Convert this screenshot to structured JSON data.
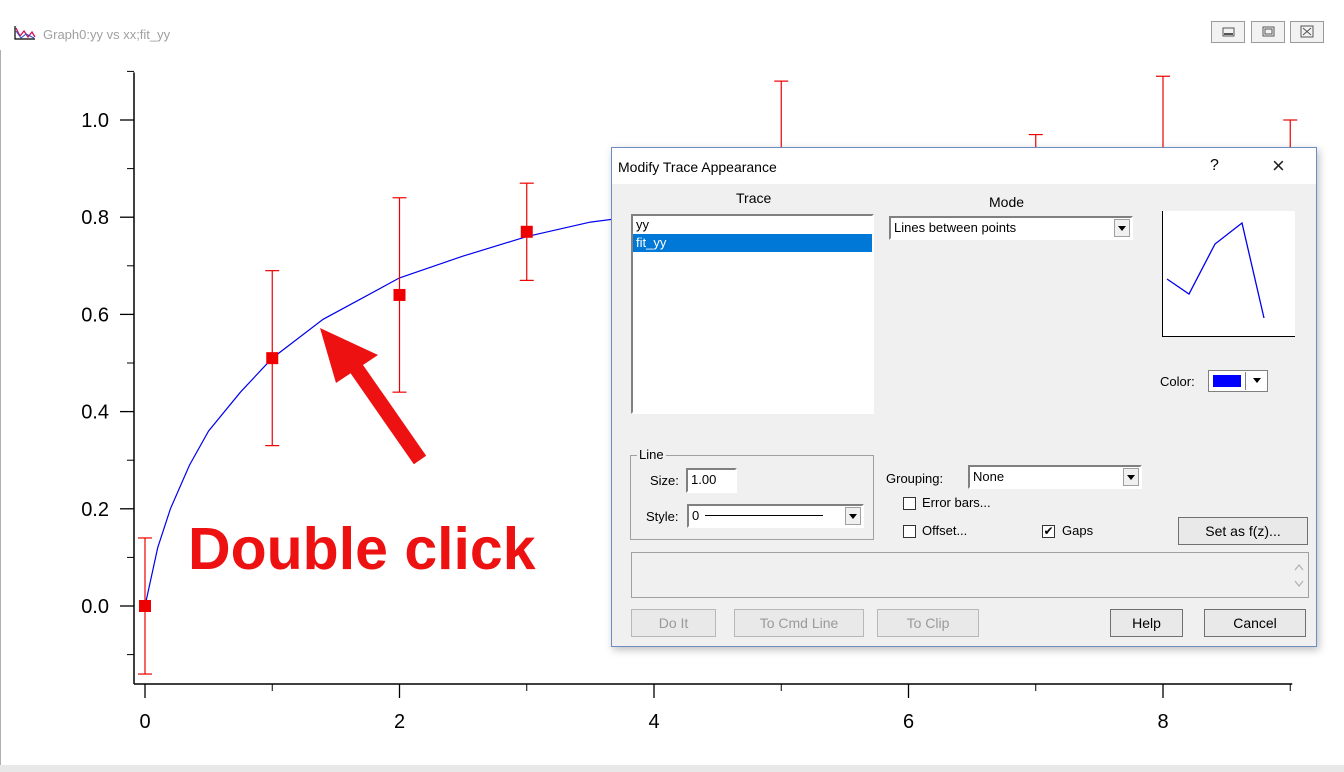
{
  "window": {
    "title": "Graph0:yy vs xx;fit_yy",
    "icon": "graph-icon"
  },
  "chart_data": {
    "type": "scatter",
    "x_ticks": [
      "0",
      "2",
      "4",
      "6",
      "8"
    ],
    "y_ticks": [
      "0.0",
      "0.2",
      "0.4",
      "0.6",
      "0.8",
      "1.0"
    ],
    "xlim": [
      0,
      9
    ],
    "ylim": [
      -0.15,
      1.1
    ],
    "series": [
      {
        "name": "yy",
        "style": "markers",
        "color": "#ee0000",
        "x": [
          0,
          1,
          2,
          3,
          5,
          7,
          8,
          9
        ],
        "y": [
          0.0,
          0.51,
          0.64,
          0.77,
          0.86,
          0.82,
          0.87,
          0.87
        ],
        "err": [
          0.14,
          0.18,
          0.2,
          0.1,
          0.22,
          0.15,
          0.22,
          0.13
        ]
      },
      {
        "name": "fit_yy",
        "style": "line",
        "color": "#0000ee",
        "x": [
          0,
          0.1,
          0.2,
          0.35,
          0.5,
          0.75,
          1.0,
          1.4,
          2.0,
          2.5,
          3.0,
          3.5,
          3.8
        ],
        "y": [
          0.0,
          0.12,
          0.2,
          0.29,
          0.36,
          0.44,
          0.51,
          0.59,
          0.675,
          0.72,
          0.76,
          0.79,
          0.8
        ]
      }
    ],
    "annotation": "Double click",
    "grid": false
  },
  "dialog": {
    "title": "Modify Trace Appearance",
    "help_glyph": "?",
    "close_glyph": "×",
    "trace_label": "Trace",
    "traces": [
      "yy",
      "fit_yy"
    ],
    "selected_trace": "fit_yy",
    "mode_label": "Mode",
    "mode_value": "Lines between points",
    "color_label": "Color:",
    "color_value": "#0000ff",
    "line_group_label": "Line",
    "size_label": "Size:",
    "size_value": "1.00",
    "style_label": "Style:",
    "style_value": "0",
    "grouping_label": "Grouping:",
    "grouping_value": "None",
    "error_bars_label": "Error bars...",
    "error_bars_checked": false,
    "offset_label": "Offset...",
    "offset_checked": false,
    "gaps_label": "Gaps",
    "gaps_checked": true,
    "set_as_fz_label": "Set as f(z)...",
    "do_it_label": "Do It",
    "to_cmd_line_label": "To Cmd Line",
    "to_clip_label": "To Clip",
    "help_label": "Help",
    "cancel_label": "Cancel"
  }
}
